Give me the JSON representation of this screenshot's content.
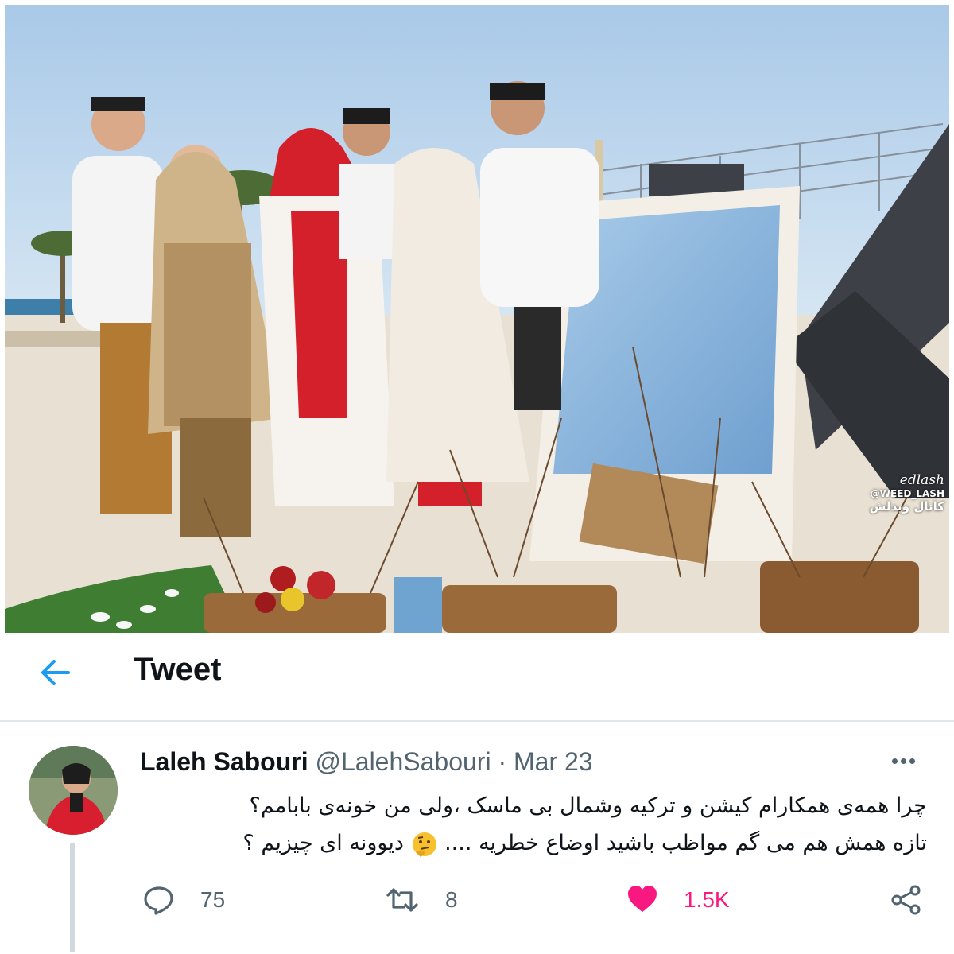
{
  "photo": {
    "watermark_brand": "edlash",
    "watermark_handle": "@WEED_LASH",
    "watermark_channel": "کانال ویدلش"
  },
  "header": {
    "back_icon": "arrow-left-icon",
    "title": "Tweet",
    "accent_color": "#1d9bf0"
  },
  "tweet": {
    "author_name": "Laleh Sabouri",
    "author_handle": "@LalehSabouri",
    "separator": "·",
    "date": "Mar 23",
    "more_icon": "more-dots-icon",
    "text_line_1": "چرا همه‌ی همکارام کیشن و ترکیه وشمال بی ماسک ،ولی من خونه‌ی بابامم؟",
    "text_line_2_part_1": "تازه همش هم می گم مواظب باشید اوضاع خطریه ....",
    "text_line_2_emoji": "thinking-face-emoji",
    "text_line_2_part_2": "دیوونه ای چیزیم ؟",
    "actions": {
      "reply": {
        "icon": "reply-icon",
        "count": "75"
      },
      "retweet": {
        "icon": "retweet-icon",
        "count": "8"
      },
      "like": {
        "icon": "heart-icon",
        "count": "1.5K",
        "color": "#f91880"
      },
      "share": {
        "icon": "share-icon"
      }
    }
  }
}
